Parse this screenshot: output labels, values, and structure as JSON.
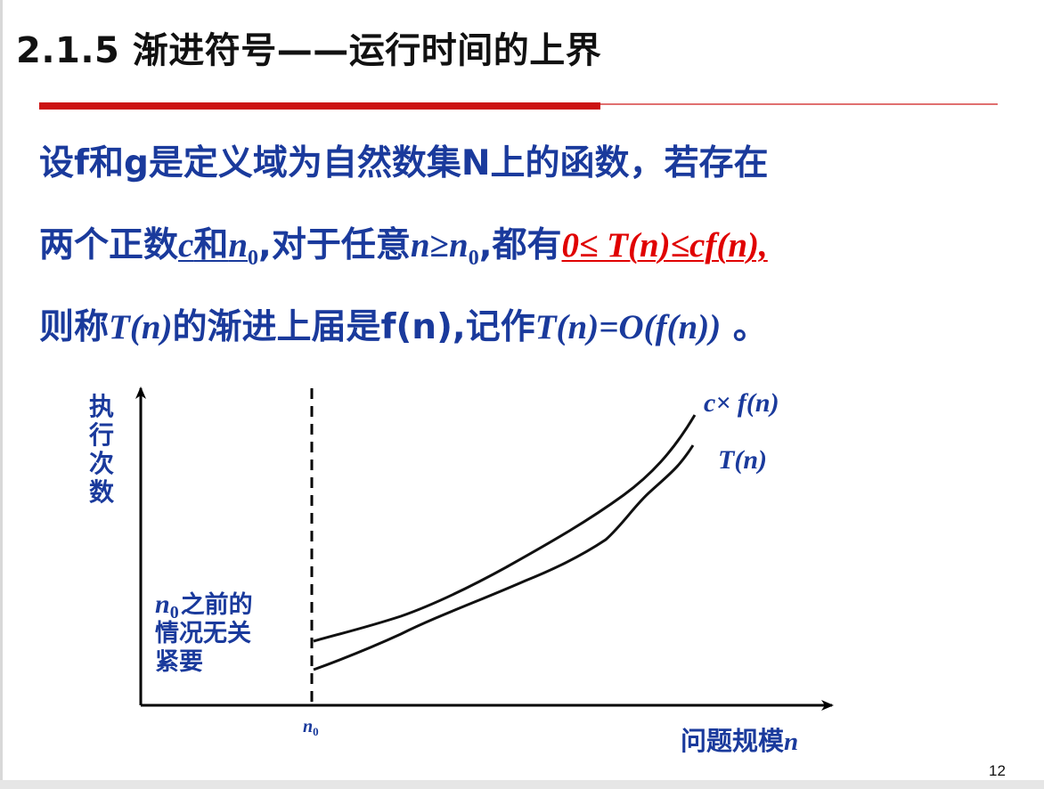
{
  "slide": {
    "title": "2.1.5 渐进符号——运行时间的上界",
    "page_number": "12"
  },
  "definition": {
    "line1": "设f和g是定义域为自然数集N上的函数，若存在",
    "line2": {
      "lead": "两个正数",
      "c": "c",
      "he": "和",
      "n": "n",
      "sub0": "0",
      "mid": ",对于任意",
      "n2": "n",
      "geq": "≥",
      "n3": "n",
      "sub0b": "0",
      "mid2": ",都有",
      "inequality": "0≤ T(n)≤cf(n),"
    },
    "line3": {
      "lead": "则称",
      "Tn": "T(n)",
      "mid": "的渐进上届是f(n),记作",
      "expr": "T(n)=O(f(n))",
      "tail": " 。"
    }
  },
  "figure": {
    "y_axis_label": "执行次数",
    "x_axis_label": "问题规模",
    "x_axis_var": "n",
    "n0_tick": "n",
    "n0_sub": "0",
    "region_note_var": "n",
    "region_note_sub": "0",
    "region_note_1": "之前的",
    "region_note_2": "情况无关",
    "region_note_3": "紧要",
    "curve_upper_label": "c× f(n)",
    "curve_lower_label": "T(n)",
    "colors": {
      "curves": "#111111",
      "labels": "#1a3a9c",
      "axes": "#000000"
    }
  }
}
